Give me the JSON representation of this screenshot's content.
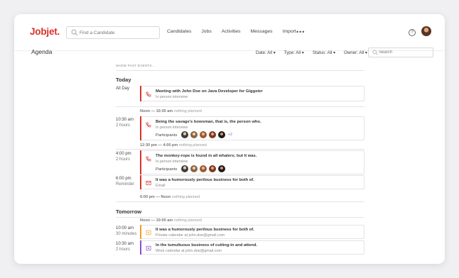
{
  "app": {
    "logo": "Jobjet."
  },
  "nav": {
    "search_placeholder": "Find a Candidate",
    "links": [
      "Candidates",
      "Jobs",
      "Activities",
      "Messages",
      "Import"
    ],
    "more": "•••",
    "help": "?"
  },
  "page": {
    "title": "Agenda",
    "filters": [
      "Date: All",
      "Type: All",
      "Status: All",
      "Owner: All"
    ],
    "search_placeholder": "Search",
    "show_past": "SHOW PAST EVENTS..."
  },
  "colors": {
    "brand": "#d8332c",
    "accent_orange": "#f0a020",
    "accent_purple": "#8a4fc8",
    "link": "#4a7fd4"
  },
  "today": {
    "label": "Today",
    "events": [
      {
        "time": "All Day",
        "duration": "",
        "title": "Meeting with John Doe on Java Developer for Giggster",
        "subtitle": "In person interview",
        "icon": "phone-icon"
      },
      {
        "time": "10:30 am",
        "duration": "2 hours",
        "title": "Being the savage's bowsman, that is, the person who.",
        "subtitle": "In person interview",
        "icon": "phone-icon",
        "participants_label": "Participants",
        "participants_more": "+2"
      },
      {
        "time": "4:00 pm",
        "duration": "2 hours",
        "title": "The monkey-rope is found in all whalers; but it was.",
        "subtitle": "In person interview",
        "icon": "phone-icon",
        "participants_label": "Participants"
      },
      {
        "time": "6:00 pm",
        "duration": "Reminder",
        "title": "It was a humorously perilous business for both of.",
        "subtitle": "Email",
        "icon": "mail-icon"
      }
    ],
    "gaps": [
      {
        "range": "Noon — 10:30 am",
        "note": "nothing planned"
      },
      {
        "range": "12:30 pm — 4:00 pm",
        "note": "nothing planned"
      },
      {
        "range": "6:00 pm — Noon",
        "note": "nothing planned"
      }
    ]
  },
  "tomorrow": {
    "label": "Tomorrow",
    "gap": {
      "range": "Noon — 10:00 am",
      "note": "nothing planned"
    },
    "events": [
      {
        "time": "10:00 am",
        "duration": "30 minutes",
        "title": "It was a humorously perilous business for both of.",
        "subtitle": "Private calendar at john.doe@gmail.com",
        "icon": "calendar-flag-icon"
      },
      {
        "time": "10:30 am",
        "duration": "2 hours",
        "title": "In the tumultuous business of cutting-in and attend.",
        "subtitle": "Work calendar at john.doe@gmail.com",
        "icon": "calendar-flag-icon"
      }
    ]
  }
}
